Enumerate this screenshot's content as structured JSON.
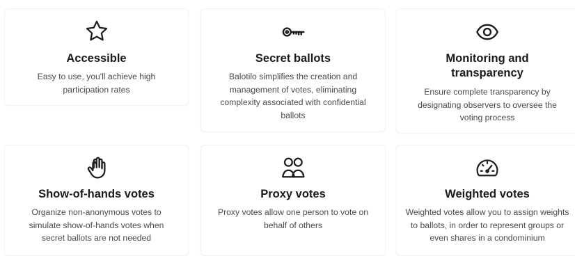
{
  "colors": {
    "title": "#1b1b1b",
    "text": "#4a4a4a",
    "icon": "#1c1c1c",
    "card_border": "#f1f1f1"
  },
  "features": [
    {
      "icon": "star-icon",
      "title": "Accessible",
      "description": "Easy to use, you'll achieve high participation rates"
    },
    {
      "icon": "key-icon",
      "title": "Secret ballots",
      "description": "Balotilo simplifies the creation and management of votes, eliminating complexity associated with confidential ballots"
    },
    {
      "icon": "eye-icon",
      "title": "Monitoring and transparency",
      "description": "Ensure complete transparency by designating observers to oversee the voting process"
    },
    {
      "icon": "raised-hand-icon",
      "title": "Show-of-hands votes",
      "description": "Organize non-anonymous votes to simulate show-of-hands votes when secret ballots are not needed"
    },
    {
      "icon": "users-icon",
      "title": "Proxy votes",
      "description": "Proxy votes allow one person to vote on behalf of others"
    },
    {
      "icon": "gauge-icon",
      "title": "Weighted votes",
      "description": "Weighted votes allow you to assign weights to ballots, in order to represent groups or even shares in a condominium"
    }
  ]
}
